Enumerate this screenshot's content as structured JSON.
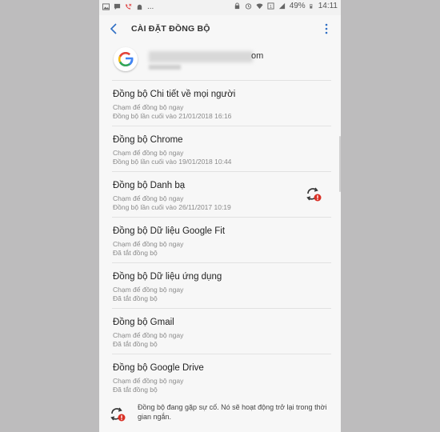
{
  "status_bar": {
    "battery": "49%",
    "time": "14:11",
    "left_text": "..."
  },
  "header": {
    "title": "CÀI ĐẶT ĐỒNG BỘ"
  },
  "account": {
    "email_visible": "om",
    "provider_icon": "google-icon"
  },
  "sync_items": [
    {
      "title": "Đồng bộ Chi tiết về mọi người",
      "line1": "Chạm để đồng bộ ngay",
      "line2": "Đồng bộ lần cuối vào 21/01/2018  16:16",
      "error": false
    },
    {
      "title": "Đồng bộ Chrome",
      "line1": "Chạm để đồng bộ ngay",
      "line2": "Đồng bộ lần cuối vào 19/01/2018  10:44",
      "error": false
    },
    {
      "title": "Đồng bộ Danh bạ",
      "line1": "Chạm để đồng bộ ngay",
      "line2": "Đồng bộ lần cuối vào 26/11/2017  10:19",
      "error": true
    },
    {
      "title": "Đồng bộ Dữ liệu Google Fit",
      "line1": "Chạm để đồng bộ ngay",
      "line2": "Đã tắt đồng bộ",
      "error": false
    },
    {
      "title": "Đồng bộ Dữ liệu ứng dụng",
      "line1": "Chạm để đồng bộ ngay",
      "line2": "Đã tắt đồng bộ",
      "error": false
    },
    {
      "title": "Đồng bộ Gmail",
      "line1": "Chạm để đồng bộ ngay",
      "line2": "Đã tắt đồng bộ",
      "error": false
    },
    {
      "title": "Đồng bộ Google Drive",
      "line1": "Chạm để đồng bộ ngay",
      "line2": "Đã tắt đồng bộ",
      "error": false
    }
  ],
  "footer": {
    "message": "Đồng bộ đang gặp sự cố. Nó sẽ hoạt động trở lại trong thời gian ngắn."
  },
  "colors": {
    "accent": "#2f6fc4",
    "error": "#d93025",
    "background": "#f7f7f7"
  }
}
